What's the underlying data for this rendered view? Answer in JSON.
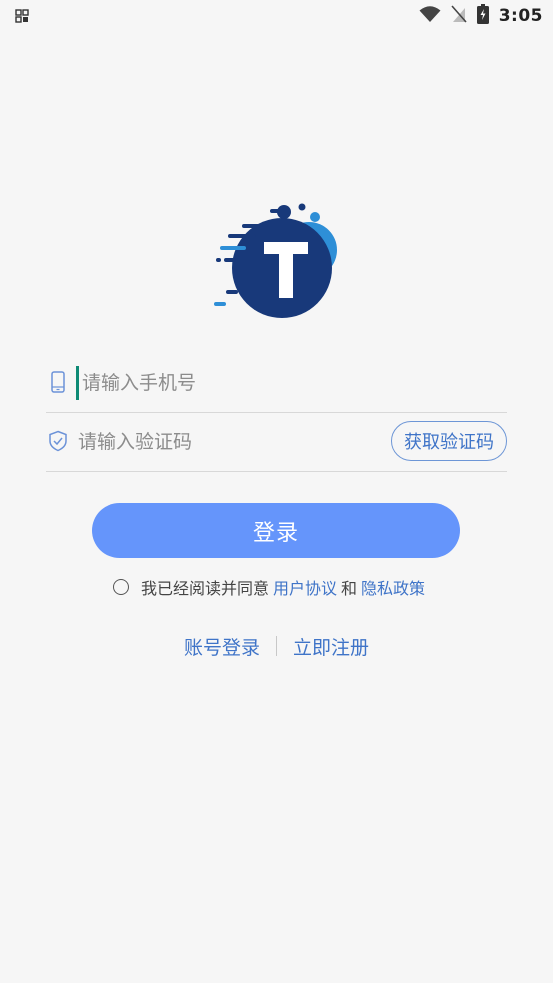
{
  "status_bar": {
    "time": "3:05",
    "icons": [
      "notification-grid-icon",
      "wifi-icon",
      "no-signal-icon",
      "battery-charging-icon"
    ]
  },
  "logo": {
    "letter": "T",
    "colors": {
      "navy": "#18397a",
      "blue": "#2e8fd7"
    }
  },
  "form": {
    "phone_placeholder": "请输入手机号",
    "code_placeholder": "请输入验证码",
    "get_code_label": "获取验证码"
  },
  "login_button": {
    "label": "登录",
    "color": "#6595fb"
  },
  "agreement": {
    "prefix": "我已经阅读并同意",
    "user_agreement": "用户协议",
    "and": "和",
    "privacy_policy": "隐私政策"
  },
  "bottom_links": {
    "account_login": "账号登录",
    "register": "立即注册"
  },
  "colors": {
    "link": "#3f74c8",
    "background": "#f6f6f6"
  }
}
